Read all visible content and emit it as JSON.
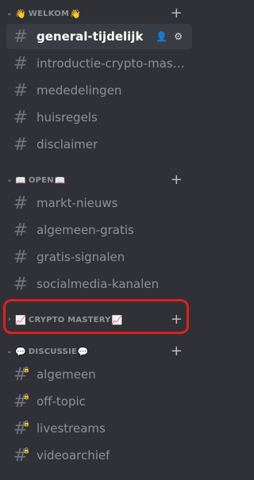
{
  "categories": [
    {
      "name": "WELKOM",
      "emoji_left": "👋",
      "emoji_right": "👋",
      "collapsed": false
    },
    {
      "name": "OPEN",
      "emoji_left": "📖",
      "emoji_right": "📖",
      "collapsed": false
    },
    {
      "name": "CRYPTO MASTERY",
      "emoji_left": "📈",
      "emoji_right": "📈",
      "collapsed": true
    },
    {
      "name": "DISCUSSIE",
      "emoji_left": "💬",
      "emoji_right": "💬",
      "collapsed": false
    }
  ],
  "channels": {
    "welkom": [
      "general-tijdelijk",
      "introductie-crypto-maste...",
      "mededelingen",
      "huisregels",
      "disclaimer"
    ],
    "open": [
      "markt-nieuws",
      "algemeen-gratis",
      "gratis-signalen",
      "socialmedia-kanalen"
    ],
    "discussie": [
      "algemeen",
      "off-topic",
      "livestreams",
      "videoarchief"
    ]
  },
  "icons": {
    "hash": "#",
    "plus": "+",
    "chevron_down": "⌄",
    "chevron_right": "›",
    "add_member": "👤",
    "settings": "⚙"
  },
  "colors": {
    "background": "#2f3136",
    "active_channel": "#393c43",
    "highlight": "#e01e1e",
    "text_muted": "#8e9297"
  }
}
